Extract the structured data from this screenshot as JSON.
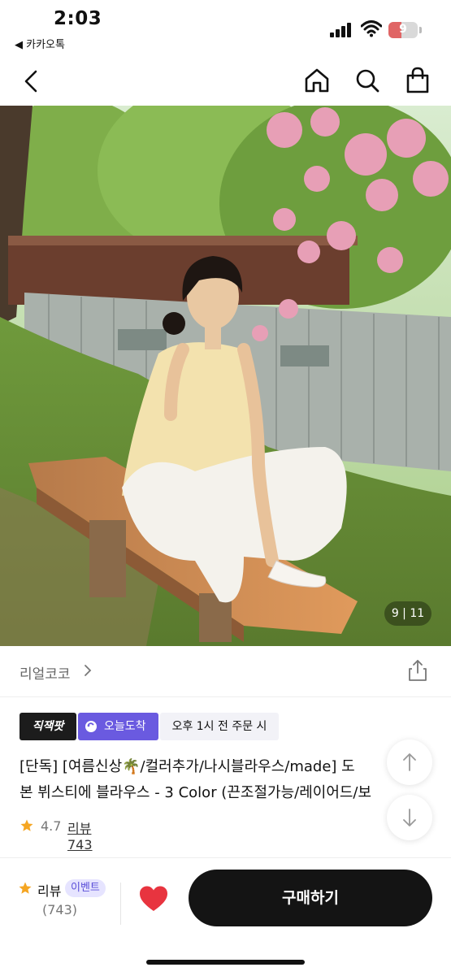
{
  "status_bar": {
    "time": "2:03",
    "back_app": "◀ 카카오톡",
    "battery": "9"
  },
  "nav": {
    "icons": [
      "chevron-left-icon",
      "home-icon",
      "search-icon",
      "shopping-bag-icon"
    ]
  },
  "gallery": {
    "counter": "9 | 11",
    "current": 9,
    "total": 11
  },
  "store": {
    "name": "리얼코코"
  },
  "badges": {
    "brand": "직잭팟",
    "today_delivery": "오늘도착",
    "cutoff": "오후 1시 전 주문 시"
  },
  "product": {
    "title_line1": "[단독] [여름신상🌴/컬러추가/나시블라우스/made] 도",
    "title_line2": "본 뷔스티에 블라우스 - 3 Color (끈조절가능/레이어드/보",
    "rating": "4.7",
    "review_link": "리뷰 743"
  },
  "bottom_bar": {
    "review_label": "리뷰",
    "event_badge": "이벤트",
    "review_count": "(743)",
    "buy_button": "구매하기"
  },
  "colors": {
    "accent_purple": "#6a5ae0",
    "buy_button": "#141414",
    "heart": "#e8343f",
    "star": "#f5a623"
  }
}
